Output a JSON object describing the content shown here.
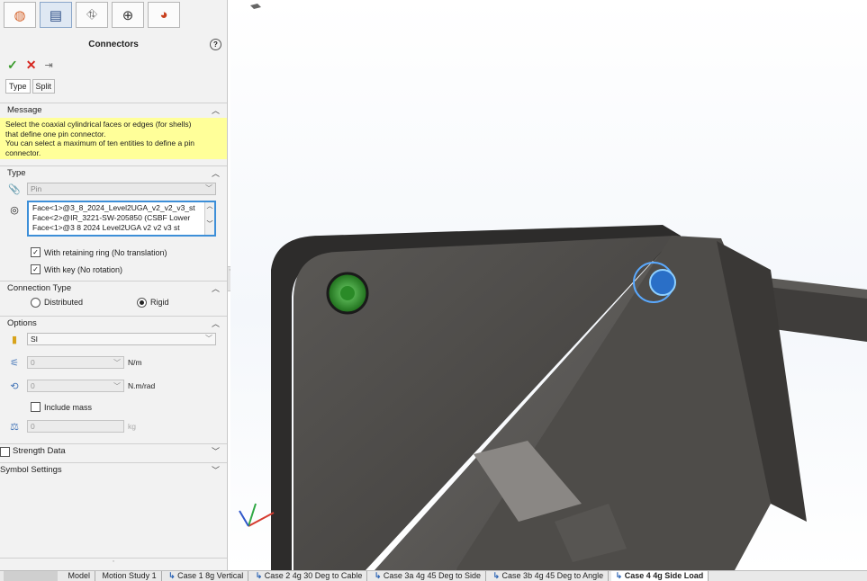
{
  "featuremanager": {
    "tabs": [
      {
        "name": "display-manager-tab-icon",
        "glyph": "◍"
      },
      {
        "name": "feature-tree-tab-icon",
        "glyph": "▤"
      },
      {
        "name": "configuration-tab-icon",
        "glyph": "⛗"
      },
      {
        "name": "dimxpert-tab-icon",
        "glyph": "⊕"
      },
      {
        "name": "appearance-tab-icon",
        "glyph": "◕"
      }
    ]
  },
  "propertymanager": {
    "title": "Connectors",
    "subtabs": [
      "Type",
      "Split"
    ],
    "message": {
      "header": "Message",
      "lines": [
        "Select the coaxial cylindrical faces or edges (for shells)",
        "that define one pin connector.",
        "You can select a maximum of ten entities to define a pin",
        "connector."
      ]
    },
    "type": {
      "header": "Type",
      "connector_type": "Pin",
      "selections": [
        "Face<1>@3_8_2024_Level2UGA_v2_v2_v3_st",
        "Face<2>@IR_3221-SW-205850 (CSBF Lower",
        "Face<1>@3 8 2024 Level2UGA v2 v2 v3 st"
      ],
      "retaining_ring_label": "With retaining ring (No translation)",
      "key_label": "With key (No rotation)"
    },
    "connection_type": {
      "header": "Connection Type",
      "distributed_label": "Distributed",
      "rigid_label": "Rigid"
    },
    "options": {
      "header": "Options",
      "unit_system": "SI",
      "axial_stiffness": "0",
      "axial_unit": "N/m",
      "rotational_stiffness": "0",
      "rotational_unit": "N.m/rad",
      "include_mass_label": "Include mass",
      "mass": "0",
      "mass_unit": "kg"
    },
    "strength_data_label": "Strength Data",
    "symbol_settings_label": "Symbol Settings"
  },
  "bottom_tabs": [
    "Model",
    "Motion Study 1",
    "Case 1 8g Vertical",
    "Case 2 4g 30 Deg to Cable",
    "Case 3a 4g 45 Deg to Side",
    "Case 3b 4g 45 Deg to Angle",
    "Case 4 4g Side Load"
  ],
  "colors": {
    "message_bg": "#ffff99",
    "selection_border": "#3d8fd8",
    "ok": "#3a9b2c",
    "cancel": "#d6261f"
  }
}
